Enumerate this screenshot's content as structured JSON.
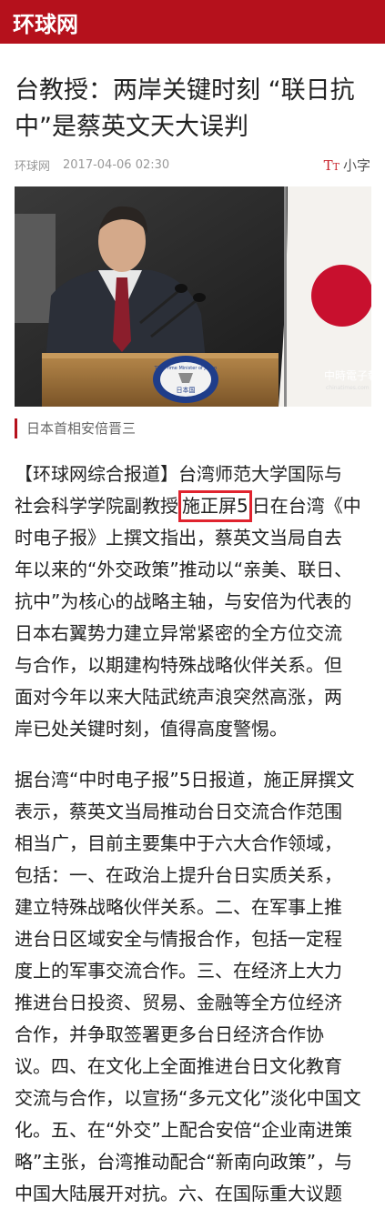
{
  "header": {
    "logo": "环球网",
    "bg_color": "#b5111c"
  },
  "article": {
    "title_lines": [
      "台教授：两岸关键时刻 “联日抗",
      "中”是蔡英文天大误判"
    ],
    "source": "环球网",
    "date": "2017-04-06 02:30",
    "font_size_icon": "TT",
    "font_size_label": "小字",
    "photo": {
      "seal_top_text": "The Prime Minister of Japan",
      "seal_bottom_text": "日本国",
      "watermark": "中時電子報",
      "watermark_sub": "chinatimes.com"
    },
    "caption": "日本首相安倍晋三",
    "p1": {
      "l1": "【环球网综合报道】台湾师范大学国际与",
      "l2_pre": "社会科学学院副教授",
      "l2_highlight": "施正屏5",
      "l2_post": "日在台湾《中",
      "l3": "时电子报》上撰文指出，蔡英文当局自去",
      "l4": "年以来的“外交政策”推动以“亲美、联日、",
      "l5": "抗中”为核心的战略主轴，与安倍为代表的",
      "l6": "日本右翼势力建立异常紧密的全方位交流",
      "l7": "与合作，以期建构特殊战略伙伴关系。但",
      "l8": "面对今年以来大陆武统声浪突然高涨，两",
      "l9": "岸已处关键时刻，值得高度警惕。"
    },
    "p2_lines": [
      "据台湾“中时电子报”5日报道，施正屏撰文",
      "表示，蔡英文当局推动台日交流合作范围",
      "相当广，目前主要集中于六大合作领域，",
      "包括：一、在政治上提升台日实质关系，",
      "建立特殊战略伙伴关系。二、在军事上推",
      "进台日区域安全与情报合作，包括一定程",
      "度上的军事交流合作。三、在经济上大力",
      "推进台日投资、贸易、金融等全方位经济",
      "合作，并争取签署更多台日经济合作协",
      "议。四、在文化上全面推进台日文化教育",
      "交流与合作，以宣扬“多元文化”淡化中国文",
      "化。五、在“外交”上配合安倍“企业南进策",
      "略”主张，台湾推动配合“新南向政策”，与",
      "中国大陆展开对抗。六、在国际重大议题"
    ]
  }
}
